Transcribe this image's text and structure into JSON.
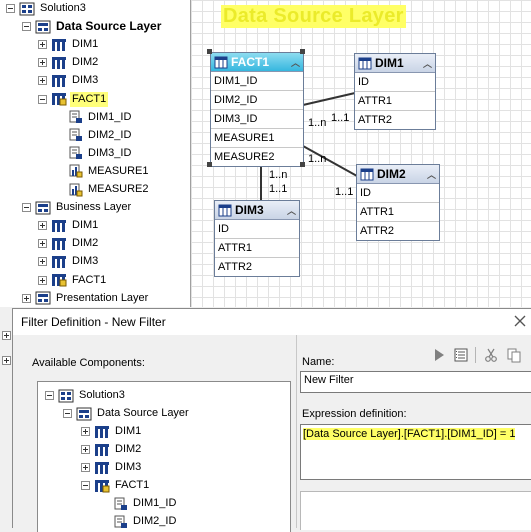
{
  "tree": {
    "items": [
      {
        "label": "Solution3",
        "level": 0,
        "expander": "minus",
        "icon": "solution-icon"
      },
      {
        "label": "Data Source Layer",
        "level": 1,
        "expander": "minus",
        "icon": "layer-icon",
        "bold": true
      },
      {
        "label": "DIM1",
        "level": 2,
        "expander": "plus",
        "icon": "dimension-table-icon"
      },
      {
        "label": "DIM2",
        "level": 2,
        "expander": "plus",
        "icon": "dimension-table-icon"
      },
      {
        "label": "DIM3",
        "level": 2,
        "expander": "plus",
        "icon": "dimension-table-icon"
      },
      {
        "label": "FACT1",
        "level": 2,
        "expander": "minus",
        "icon": "fact-table-icon",
        "highlight": true
      },
      {
        "label": "DIM1_ID",
        "level": 3,
        "expander": "none",
        "icon": "key-column-icon"
      },
      {
        "label": "DIM2_ID",
        "level": 3,
        "expander": "none",
        "icon": "key-column-icon"
      },
      {
        "label": "DIM3_ID",
        "level": 3,
        "expander": "none",
        "icon": "key-column-icon"
      },
      {
        "label": "MEASURE1",
        "level": 3,
        "expander": "none",
        "icon": "measure-icon"
      },
      {
        "label": "MEASURE2",
        "level": 3,
        "expander": "none",
        "icon": "measure-icon"
      },
      {
        "label": "Business Layer",
        "level": 1,
        "expander": "minus",
        "icon": "layer-icon"
      },
      {
        "label": "DIM1",
        "level": 2,
        "expander": "plus",
        "icon": "dimension-table-icon"
      },
      {
        "label": "DIM2",
        "level": 2,
        "expander": "plus",
        "icon": "dimension-table-icon"
      },
      {
        "label": "DIM3",
        "level": 2,
        "expander": "plus",
        "icon": "dimension-table-icon"
      },
      {
        "label": "FACT1",
        "level": 2,
        "expander": "plus",
        "icon": "fact-table-icon"
      },
      {
        "label": "Presentation Layer",
        "level": 1,
        "expander": "plus",
        "icon": "layer-icon"
      }
    ]
  },
  "canvas": {
    "title": "Data Source Layer",
    "tables": {
      "fact1": {
        "name": "FACT1",
        "rows": [
          "DIM1_ID",
          "DIM2_ID",
          "DIM3_ID",
          "MEASURE1",
          "MEASURE2"
        ]
      },
      "dim1": {
        "name": "DIM1",
        "rows": [
          "ID",
          "ATTR1",
          "ATTR2"
        ]
      },
      "dim2": {
        "name": "DIM2",
        "rows": [
          "ID",
          "ATTR1",
          "ATTR2"
        ]
      },
      "dim3": {
        "name": "DIM3",
        "rows": [
          "ID",
          "ATTR1",
          "ATTR2"
        ]
      }
    },
    "cardinality": {
      "dim1_many": "1..n",
      "dim1_one": "1..1",
      "dim2_many": "1..n",
      "dim2_one": "1..1",
      "dim3_many": "1..n",
      "dim3_one": "1..1"
    }
  },
  "dialog": {
    "title": "Filter Definition - New Filter",
    "available_components_label": "Available Components:",
    "name_label": "Name:",
    "name_value": "New Filter",
    "expression_label": "Expression definition:",
    "expression_value": "[Data Source Layer].[FACT1].[DIM1_ID] = 1",
    "tree": [
      {
        "label": "Solution3",
        "level": 0,
        "expander": "minus",
        "icon": "solution-icon"
      },
      {
        "label": "Data Source Layer",
        "level": 1,
        "expander": "minus",
        "icon": "layer-icon"
      },
      {
        "label": "DIM1",
        "level": 2,
        "expander": "plus",
        "icon": "dimension-table-icon"
      },
      {
        "label": "DIM2",
        "level": 2,
        "expander": "plus",
        "icon": "dimension-table-icon"
      },
      {
        "label": "DIM3",
        "level": 2,
        "expander": "plus",
        "icon": "dimension-table-icon"
      },
      {
        "label": "FACT1",
        "level": 2,
        "expander": "minus",
        "icon": "fact-table-icon"
      },
      {
        "label": "DIM1_ID",
        "level": 3,
        "expander": "none",
        "icon": "key-column-icon"
      },
      {
        "label": "DIM2_ID",
        "level": 3,
        "expander": "none",
        "icon": "key-column-icon"
      }
    ],
    "toolbar_icons": [
      "play-icon",
      "list-icon",
      "cut-icon",
      "copy-icon"
    ]
  },
  "colors": {
    "highlight": "#ffff66",
    "selected_header": "#36b7df"
  }
}
